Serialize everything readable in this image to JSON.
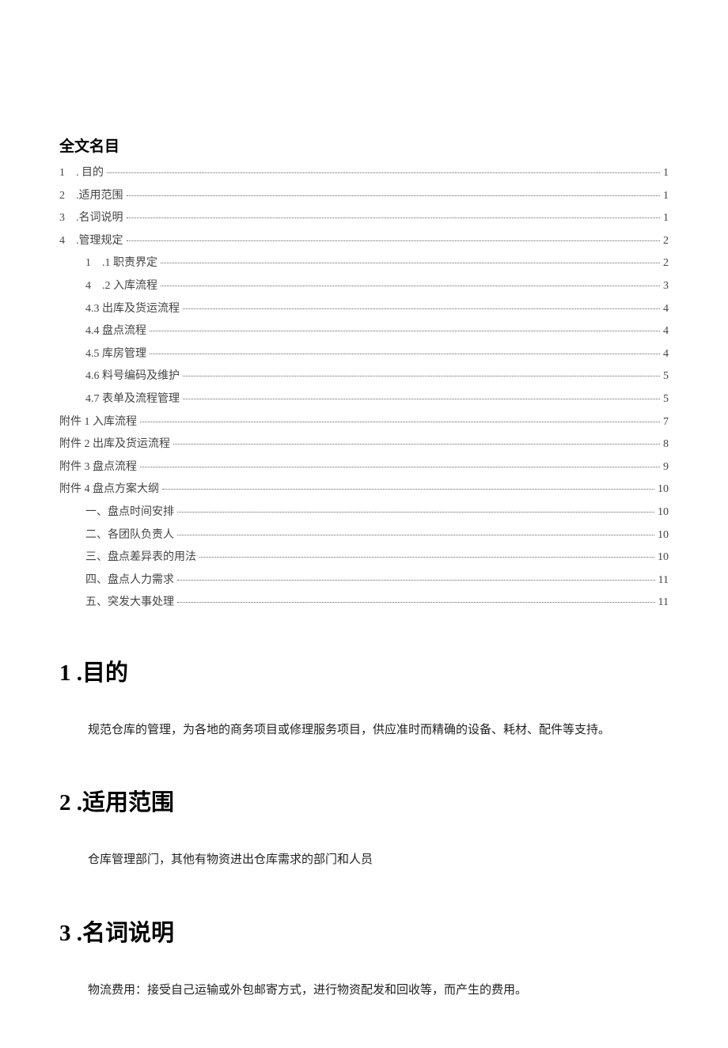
{
  "toc": {
    "title": "全文名目",
    "entries": [
      {
        "label": "1 . 目的",
        "page": "1",
        "indent": 0
      },
      {
        "label": "2 .适用范围",
        "page": "1",
        "indent": 0
      },
      {
        "label": "3 .名词说明",
        "page": "1",
        "indent": 0
      },
      {
        "label": "4 .管理规定",
        "page": "2",
        "indent": 0
      },
      {
        "label": "1 .1 职责界定",
        "page": "2",
        "indent": 1
      },
      {
        "label": "4 .2 入库流程",
        "page": "3",
        "indent": 1
      },
      {
        "label": "4.3 出库及货运流程",
        "page": "4",
        "indent": 1
      },
      {
        "label": "4.4 盘点流程",
        "page": "4",
        "indent": 1
      },
      {
        "label": "4.5 库房管理",
        "page": "4",
        "indent": 1
      },
      {
        "label": "4.6 料号编码及维护",
        "page": "5",
        "indent": 1
      },
      {
        "label": "4.7 表单及流程管理",
        "page": "5",
        "indent": 1
      },
      {
        "label": "附件 1 入库流程",
        "page": "7",
        "indent": 0
      },
      {
        "label": "附件 2 出库及货运流程",
        "page": "8",
        "indent": 0
      },
      {
        "label": "附件 3 盘点流程",
        "page": "9",
        "indent": 0
      },
      {
        "label": "附件 4 盘点方案大纲",
        "page": "10",
        "indent": 0
      },
      {
        "label": "一、盘点时间安排",
        "page": "10",
        "indent": 1
      },
      {
        "label": "二、各团队负责人",
        "page": "10",
        "indent": 1
      },
      {
        "label": "三、盘点差异表的用法",
        "page": "10",
        "indent": 1
      },
      {
        "label": "四、盘点人力需求",
        "page": "11",
        "indent": 1
      },
      {
        "label": "五、突发大事处理",
        "page": "11",
        "indent": 1
      }
    ]
  },
  "sections": [
    {
      "heading_num": "1",
      "heading_sep": ".",
      "heading_text": "目的",
      "body": "规范仓库的管理，为各地的商务项目或修理服务项目，供应准时而精确的设备、耗材、配件等支持。"
    },
    {
      "heading_num": "2",
      "heading_sep": ".",
      "heading_text": "适用范围",
      "body": "仓库管理部门，其他有物资进出仓库需求的部门和人员"
    },
    {
      "heading_num": "3",
      "heading_sep": ".",
      "heading_text": "名词说明",
      "body": "物流费用：接受自己运输或外包邮寄方式，进行物资配发和回收等，而产生的费用。"
    }
  ]
}
